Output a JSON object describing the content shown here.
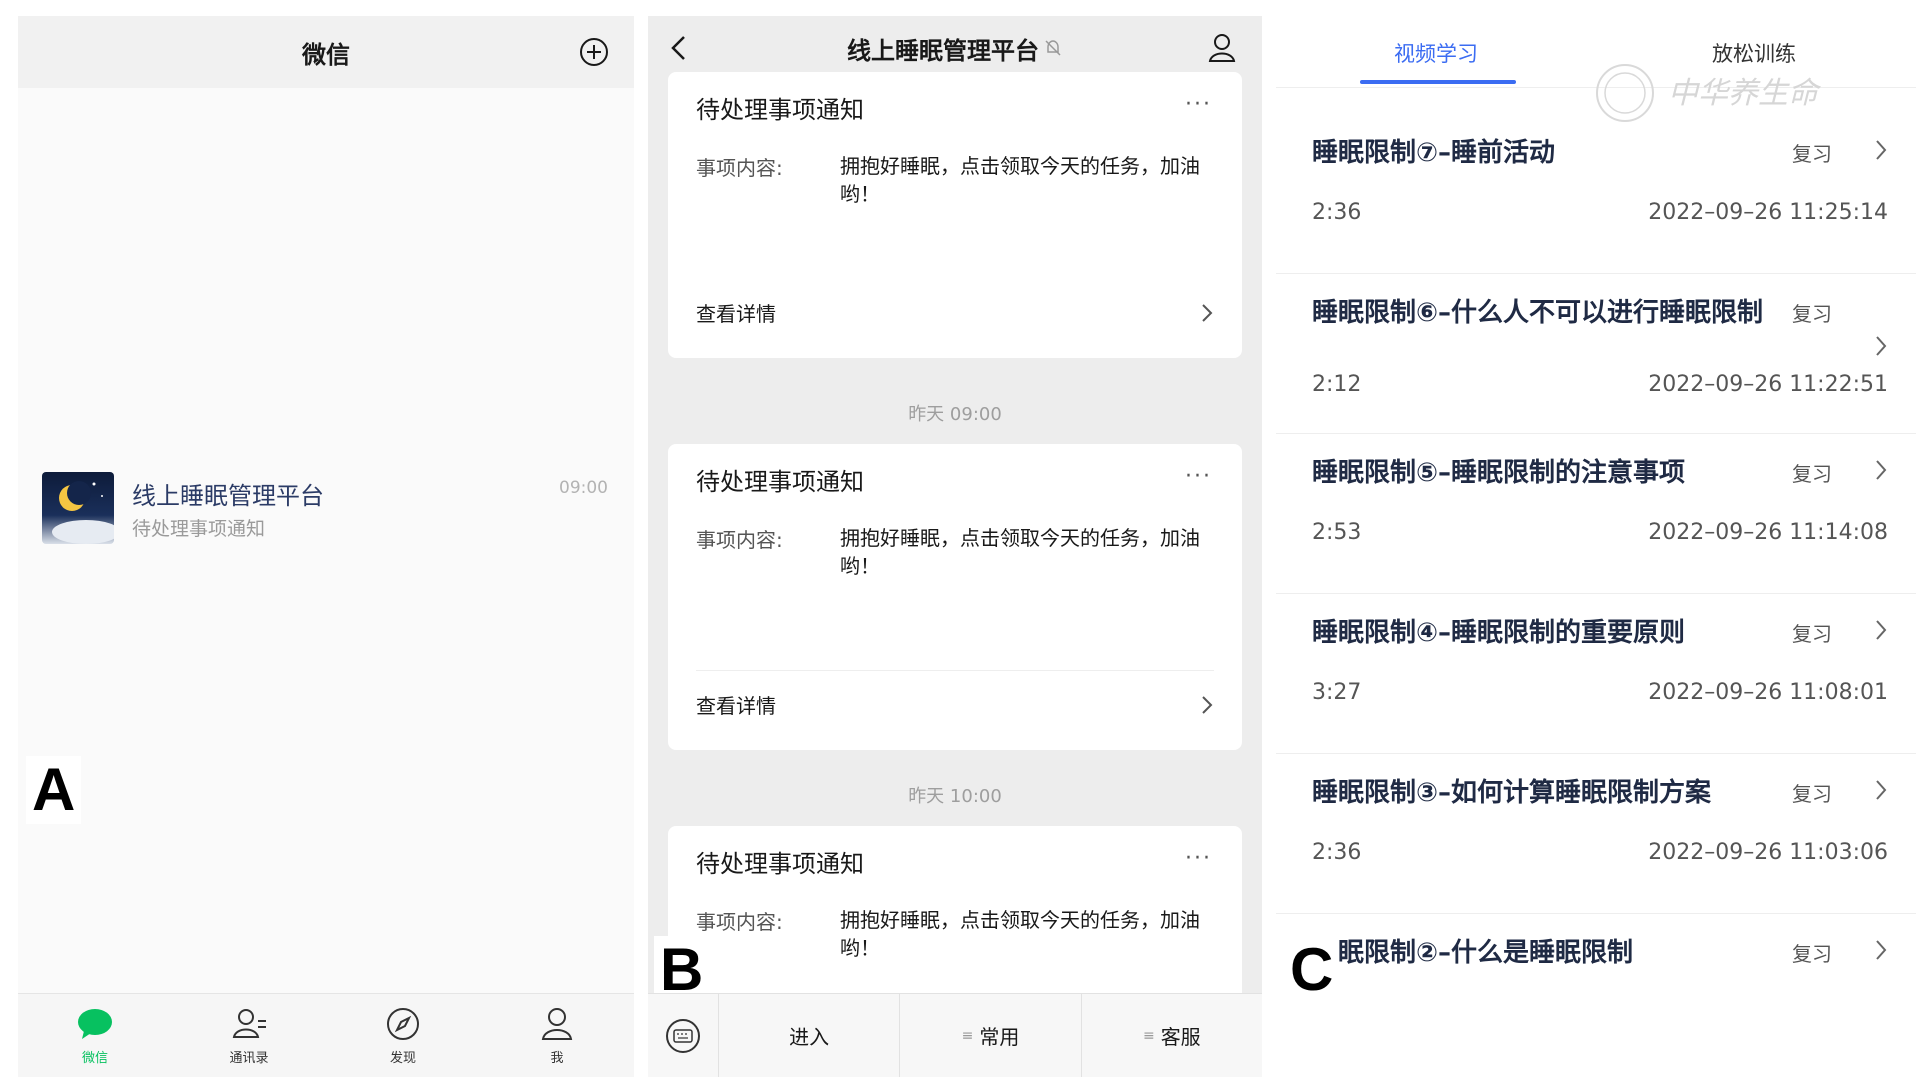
{
  "panels": {
    "a": {
      "letter": "A"
    },
    "b": {
      "letter": "B"
    },
    "c": {
      "letter": "C"
    }
  },
  "wechat": {
    "title": "微信",
    "chat": {
      "name": "线上睡眠管理平台",
      "preview": "待处理事项通知",
      "time": "09:00"
    },
    "tabs": [
      {
        "label": "微信",
        "icon": "chat-bubble-icon",
        "active": true
      },
      {
        "label": "通讯录",
        "icon": "contacts-icon",
        "active": false
      },
      {
        "label": "发现",
        "icon": "compass-icon",
        "active": false
      },
      {
        "label": "我",
        "icon": "person-icon",
        "active": false
      }
    ],
    "accent": "#07c160"
  },
  "account": {
    "title": "线上睡眠管理平台",
    "cards": [
      {
        "title": "待处理事项通知",
        "more": "···",
        "content_label": "事项内容:",
        "content": "拥抱好睡眠，点击领取今天的任务，加油哟！",
        "detail": "查看详情"
      },
      {
        "title": "待处理事项通知",
        "more": "···",
        "content_label": "事项内容:",
        "content": "拥抱好睡眠，点击领取今天的任务，加油哟！",
        "detail": "查看详情"
      },
      {
        "title": "待处理事项通知",
        "more": "···",
        "content_label": "事项内容:",
        "content": "拥抱好睡眠，点击领取今天的任务，加油哟！"
      }
    ],
    "timestamps": [
      "昨天 09:00",
      "昨天 10:00"
    ],
    "menu": [
      "进入",
      "常用",
      "客服"
    ]
  },
  "lessons": {
    "tabs": [
      "视频学习",
      "放松训练"
    ],
    "watermark": "中华养生命",
    "review_label": "复习",
    "accent": "#3b6cf2",
    "items": [
      {
        "title": "睡眠限制⑦–睡前活动",
        "duration": "2:36",
        "date": "2022–09–26 11:25:14"
      },
      {
        "title": "睡眠限制⑥–什么人不可以进行睡眠限制",
        "duration": "2:12",
        "date": "2022–09–26 11:22:51"
      },
      {
        "title": "睡眠限制⑤–睡眠限制的注意事项",
        "duration": "2:53",
        "date": "2022–09–26 11:14:08"
      },
      {
        "title": "睡眠限制④–睡眠限制的重要原则",
        "duration": "3:27",
        "date": "2022–09–26 11:08:01"
      },
      {
        "title": "睡眠限制③–如何计算睡眠限制方案",
        "duration": "2:36",
        "date": "2022–09–26 11:03:06"
      },
      {
        "title": "睡眠限制②–什么是睡眠限制"
      }
    ]
  }
}
